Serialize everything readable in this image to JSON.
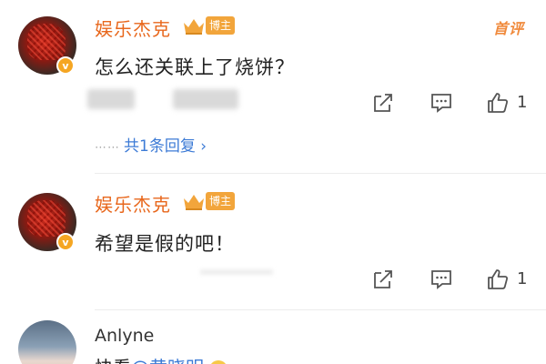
{
  "comments": [
    {
      "username": "娱乐杰克",
      "badge": "博主",
      "text": "怎么还关联上了烧饼？",
      "like_count": "1",
      "replies_label": "共1条回复",
      "first_badge": "首评"
    },
    {
      "username": "娱乐杰克",
      "badge": "博主",
      "text": "希望是假的吧！"
    },
    {
      "username": "Anlyne",
      "text_prefix": "快看",
      "mention": "@黄晓明"
    }
  ],
  "colors": {
    "username": "#e8671c",
    "badge_bg": "#f2a53b",
    "link": "#3d7bd6",
    "verified": "#f5a623"
  },
  "icons": [
    "share-icon",
    "comment-icon",
    "like-icon",
    "crown-icon",
    "verified-icon",
    "chevron-right-icon"
  ]
}
